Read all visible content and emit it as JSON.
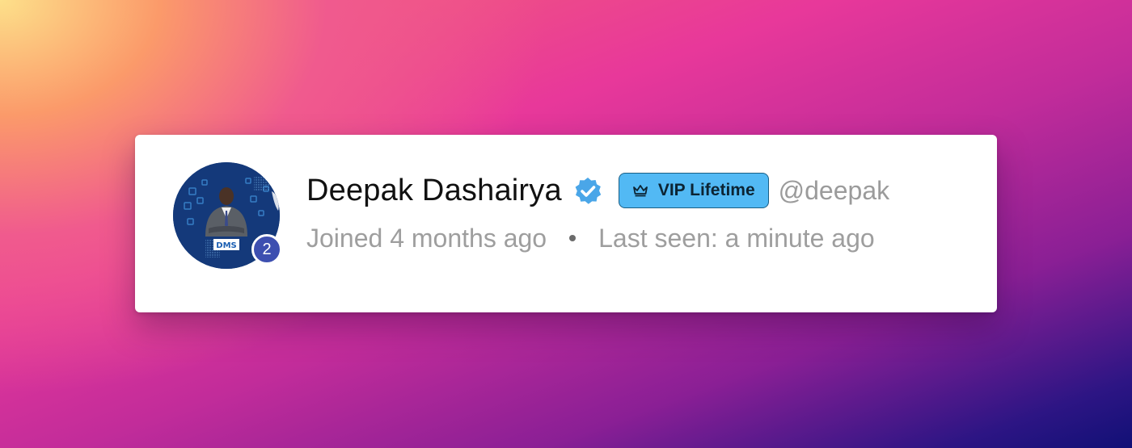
{
  "profile": {
    "name": "Deepak Dashairya",
    "handle": "@deepak",
    "badge_label": "VIP Lifetime",
    "notification_count": "2",
    "joined": "Joined 4 months ago",
    "last_seen": "Last seen: a minute ago",
    "avatar_logo_text": "DMS",
    "verified": true
  },
  "colors": {
    "badge_bg": "#52b9f4",
    "badge_border": "#1a5f86",
    "verified": "#4aa6e8",
    "notif_bg": "#3d4fb0",
    "meta_text": "#9e9e9e",
    "name_text": "#111111"
  },
  "icons": {
    "verified": "verified-badge-icon",
    "crown": "crown-icon",
    "separator": "dot-separator"
  }
}
